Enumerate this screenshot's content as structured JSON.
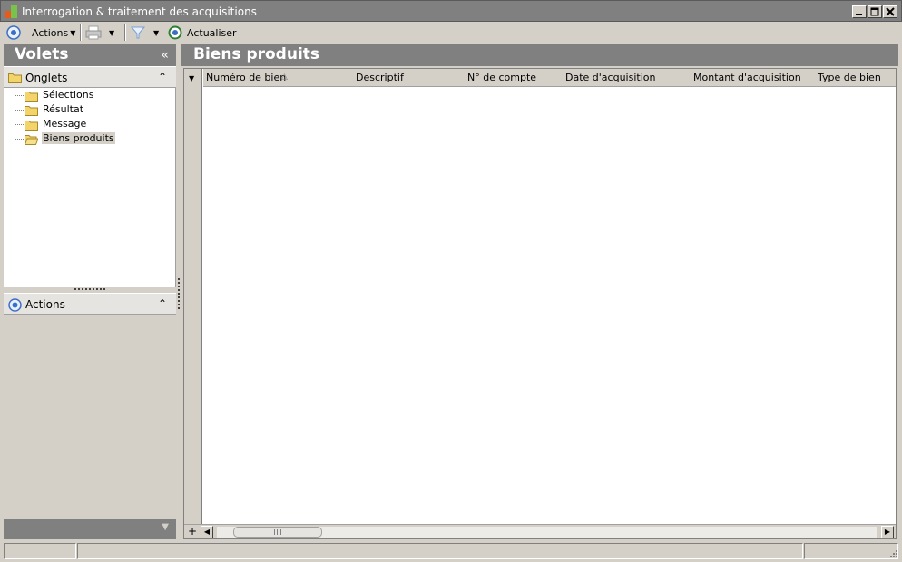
{
  "window": {
    "title": "Interrogation & traitement des acquisitions"
  },
  "toolbar": {
    "actions_label": "Actions",
    "refresh_label": "Actualiser"
  },
  "left_pane": {
    "title": "Volets",
    "collapse_glyph": "«",
    "tabs_section": {
      "label": "Onglets",
      "items": [
        {
          "label": "Sélections",
          "selected": false
        },
        {
          "label": "Résultat",
          "selected": false
        },
        {
          "label": "Message",
          "selected": false
        },
        {
          "label": "Biens produits",
          "selected": true
        }
      ]
    },
    "actions_section": {
      "label": "Actions"
    }
  },
  "main_pane": {
    "title": "Biens produits",
    "columns": [
      {
        "label": "Numéro de bien",
        "sorted": true
      },
      {
        "label": "Descriptif"
      },
      {
        "label": "N° de compte"
      },
      {
        "label": "Date d'acquisition"
      },
      {
        "label": "Montant d'acquisition"
      },
      {
        "label": "Type de bien"
      }
    ],
    "rows": []
  },
  "colors": {
    "chrome": "#d4d0c8",
    "header_gray": "#808080",
    "folder_yellow": "#f2d46a",
    "accent_blue": "#3c6fc4"
  }
}
